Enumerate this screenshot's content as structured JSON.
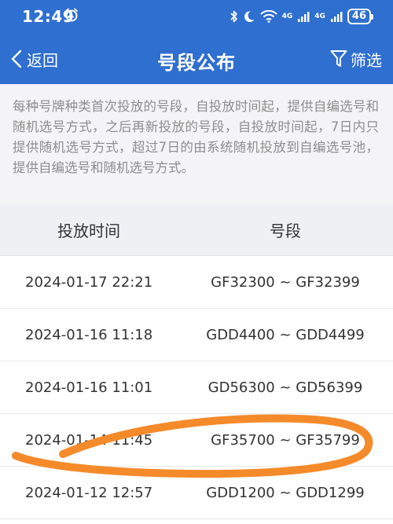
{
  "status_bar": {
    "time": "12:49",
    "network": [
      "4G",
      "4G"
    ],
    "battery": "46"
  },
  "navbar": {
    "back_label": "返回",
    "title": "号段公布",
    "filter_label": "筛选"
  },
  "notice": "每种号牌种类首次投放的号段，自投放时间起，提供自编选号和随机选号方式，之后再新投放的号段，自投放时间起，7日内只提供随机选号方式，超过7日的由系统随机投放到自编选号池，提供自编选号和随机选号方式。",
  "table": {
    "headers": [
      "投放时间",
      "号段"
    ],
    "rows": [
      {
        "time": "2024-01-17 22:21",
        "range": "GF32300 ~ GF32399"
      },
      {
        "time": "2024-01-16 11:18",
        "range": "GDD4400 ~ GDD4499"
      },
      {
        "time": "2024-01-16 11:01",
        "range": "GD56300 ~ GD56399"
      },
      {
        "time": "2024-01-14 11:45",
        "range": "GF35700 ~ GF35799"
      },
      {
        "time": "2024-01-12 12:57",
        "range": "GDD1200 ~ GDD1299"
      }
    ]
  },
  "colors": {
    "header": "#2f6fd0",
    "notice_bg": "#f4f4f6",
    "table_header_bg": "#eef0f3",
    "annotation": "#f58a2a"
  }
}
